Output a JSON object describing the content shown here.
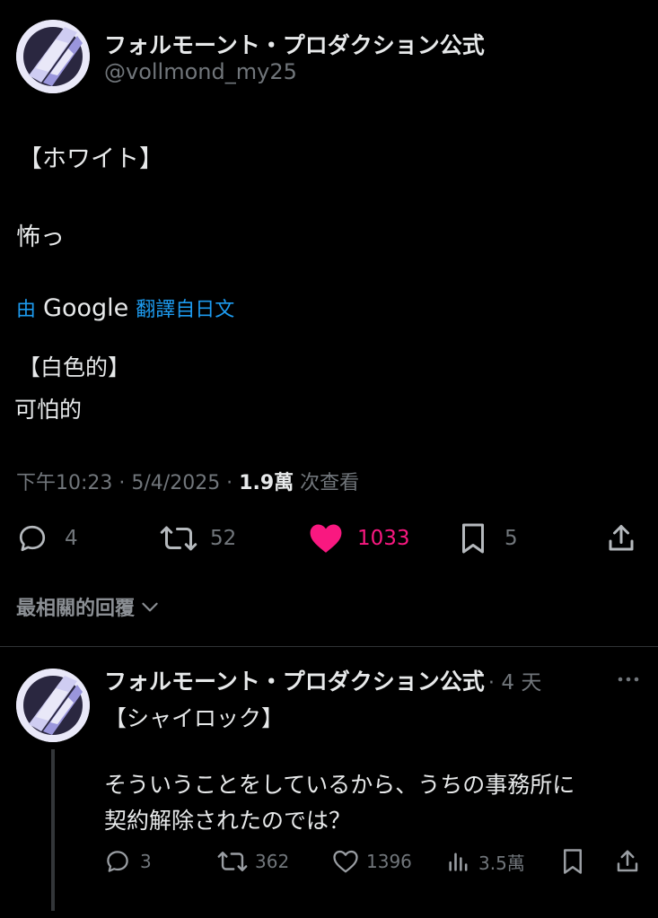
{
  "main_tweet": {
    "display_name": "フォルモーント・プロダクション公式",
    "handle": "@vollmond_my25",
    "text_line1": "【ホワイト】",
    "text_line2": "怖っ",
    "translate_prefix": "由",
    "translate_brand": "Google",
    "translate_suffix": "翻譯自日文",
    "translated_line1": "【白色的】",
    "translated_line2": "可怕的",
    "timestamp": "下午10:23 · 5/4/2025 ·",
    "views_count": "1.9萬",
    "views_label": "次查看",
    "replies": "4",
    "reposts": "52",
    "likes": "1033",
    "bookmarks": "5"
  },
  "sort": {
    "label": "最相關的回覆"
  },
  "reply": {
    "display_name": "フォルモーント・プロダクション公式",
    "age": "· 4 天",
    "more_icon": "ellipsis-icon",
    "line1": "【シャイロック】",
    "line2": "そういうことをしているから、うちの事務所に",
    "line3": "契約解除されたのでは？",
    "replies": "3",
    "reposts": "362",
    "likes": "1396",
    "views": "3.5萬"
  },
  "colors": {
    "background": "#000000",
    "text": "#e7e9ea",
    "muted": "#71767b",
    "link": "#1d9bf0",
    "like_active": "#f91880"
  }
}
